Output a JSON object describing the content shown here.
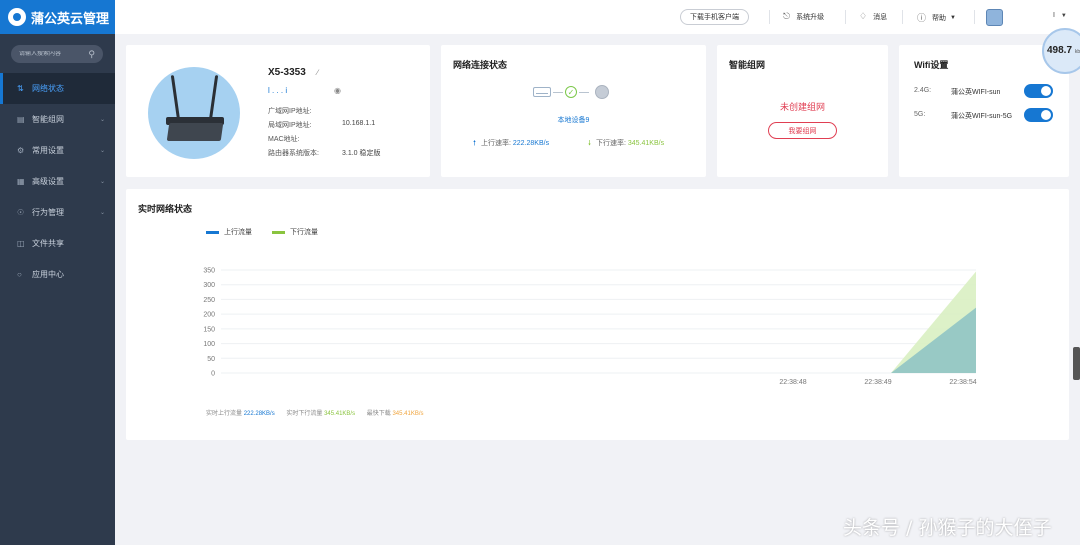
{
  "brand": {
    "title": "蒲公英云管理"
  },
  "search": {
    "placeholder": "请输入搜索内容"
  },
  "sidebar": {
    "items": [
      {
        "label": "网络状态",
        "icon": "network-icon",
        "active": true
      },
      {
        "label": "智能组网",
        "icon": "mesh-icon"
      },
      {
        "label": "常用设置",
        "icon": "gear-icon"
      },
      {
        "label": "高级设置",
        "icon": "advanced-settings-icon"
      },
      {
        "label": "行为管理",
        "icon": "behavior-icon"
      },
      {
        "label": "文件共享",
        "icon": "folder-icon"
      },
      {
        "label": "应用中心",
        "icon": "app-center-icon"
      }
    ]
  },
  "topbar": {
    "download_label": "下载手机客户端",
    "upgrade_label": "系统升级",
    "message_label": "消息",
    "help_label": "帮助",
    "user_label": "I"
  },
  "device": {
    "model": "X5-3353",
    "name": "l . . . i",
    "rows": [
      {
        "label": "广域网IP地址:",
        "value": ""
      },
      {
        "label": "局域网IP地址:",
        "value": "10.168.1.1"
      },
      {
        "label": "MAC地址:",
        "value": ""
      },
      {
        "label": "路由器系统版本:",
        "value": "3.1.0 稳定版"
      }
    ]
  },
  "network": {
    "title": "网络连接状态",
    "local_devices": "本地设备9",
    "up_label": "上行速率:",
    "up_value": "222.28KB/s",
    "down_label": "下行速率:",
    "down_value": "345.41KB/s"
  },
  "mesh": {
    "title": "智能组网",
    "status": "未创建组网",
    "button": "我要组网"
  },
  "wifi": {
    "title": "Wifi设置",
    "bands": [
      {
        "band": "2.4G:",
        "ssid": "蒲公英WIFI-sun",
        "enabled": true
      },
      {
        "band": "5G:",
        "ssid": "蒲公英WIFI-sun-5G",
        "enabled": true
      }
    ]
  },
  "speed_bubble": {
    "value": "498.7",
    "unit": "kb"
  },
  "chart_data": {
    "type": "area",
    "title": "实时网络状态",
    "xlabel": "",
    "ylabel": "",
    "ylim": [
      0,
      350
    ],
    "yticks": [
      0,
      50,
      100,
      150,
      200,
      250,
      300,
      350
    ],
    "x": [
      "22:38:48",
      "22:38:49",
      "22:38:54"
    ],
    "grid": true,
    "legend_position": "top-left",
    "series": [
      {
        "name": "上行流量",
        "color": "#1677d2",
        "values": [
          0,
          0,
          222
        ]
      },
      {
        "name": "下行流量",
        "color": "#8ac43f",
        "values": [
          0,
          0,
          345
        ]
      }
    ]
  },
  "stats": {
    "up_label": "实时上行流量",
    "up_value": "222.28KB/s",
    "down_label": "实时下行流量",
    "down_value": "345.41KB/s",
    "peak_label": "最快下载",
    "peak_value": "345.41KB/s"
  },
  "watermark": "头条号 / 孙猴子的大侄子"
}
